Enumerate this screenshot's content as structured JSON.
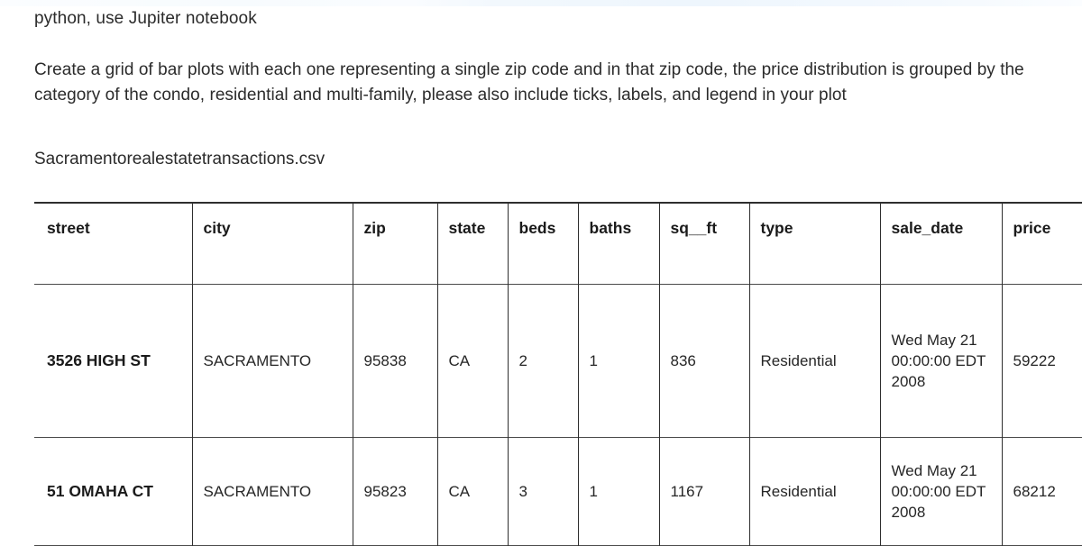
{
  "prompt": {
    "line_1": "python, use Jupiter notebook",
    "paragraph": "Create a grid of bar plots with each one representing a single zip code and in that zip code, the price distribution is grouped by the category of the condo, residential and multi-family, please also include ticks, labels, and legend in your plot",
    "filename": "Sacramentorealestatetransactions.csv"
  },
  "table": {
    "columns": [
      "street",
      "city",
      "zip",
      "state",
      "beds",
      "baths",
      "sq__ft",
      "type",
      "sale_date",
      "price"
    ],
    "rows": [
      {
        "street": "3526 HIGH ST",
        "city": "SACRAMENTO",
        "zip": "95838",
        "state": "CA",
        "beds": "2",
        "baths": "1",
        "sq__ft": "836",
        "type": "Residential",
        "sale_date": "Wed May 21 00:00:00 EDT 2008",
        "price": "59222"
      },
      {
        "street": "51 OMAHA CT",
        "city": "SACRAMENTO",
        "zip": "95823",
        "state": "CA",
        "beds": "3",
        "baths": "1",
        "sq__ft": "1167",
        "type": "Residential",
        "sale_date": "Wed May 21 00:00:00 EDT 2008",
        "price": "68212"
      }
    ]
  },
  "colors": {
    "text": "#2b2b2b",
    "rule": "#2e2e2e",
    "top_tint": "#f2f8fd"
  }
}
